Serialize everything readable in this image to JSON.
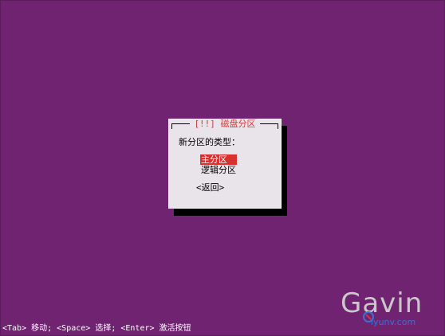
{
  "dialog": {
    "title": "[!!] 磁盘分区",
    "prompt": "新分区的类型：",
    "options": [
      {
        "label": "主分区",
        "selected": true
      },
      {
        "label": "逻辑分区",
        "selected": false
      }
    ],
    "back_label": "<返回>"
  },
  "status_bar": {
    "text": "<Tab> 移动; <Space> 选择; <Enter> 激活按钮"
  },
  "watermark": {
    "text": "Gavin",
    "url": "iyunv.com"
  },
  "colors": {
    "background": "#6f2370",
    "dialog_bg": "#e9e4e9",
    "title": "#d43a3a",
    "selection": "#d93030"
  }
}
